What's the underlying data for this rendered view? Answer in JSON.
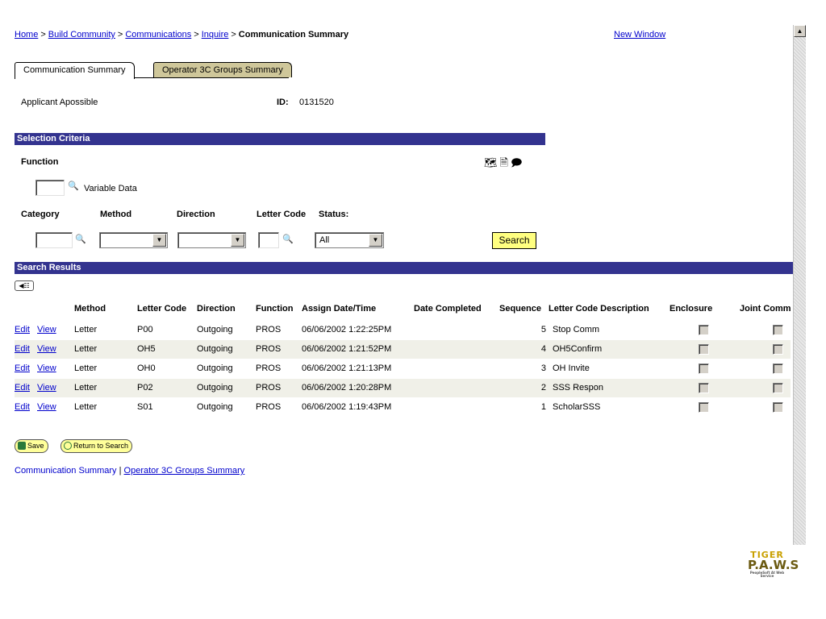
{
  "breadcrumb": {
    "items": [
      "Home",
      "Build Community",
      "Communications",
      "Inquire"
    ],
    "separator": ">",
    "current": "Communication Summary"
  },
  "new_window": "New Window",
  "tabs": [
    {
      "label": "Communication Summary",
      "active": true
    },
    {
      "label": "Operator 3C Groups Summary",
      "active": false
    }
  ],
  "applicant": {
    "name": "Applicant Apossible",
    "id_label": "ID:",
    "id_value": "0131520"
  },
  "selection": {
    "title": "Selection Criteria",
    "function_label": "Function",
    "variable_data": "Variable Data",
    "category_label": "Category",
    "method_label": "Method",
    "direction_label": "Direction",
    "letter_code_label": "Letter Code",
    "status_label": "Status:",
    "status_value": "All",
    "search_button": "Search",
    "tool_icons": [
      "download-to-excel-icon",
      "view-all-icon",
      "find-icon"
    ]
  },
  "results": {
    "title": "Search Results",
    "columns": [
      "Method",
      "Letter Code",
      "Direction",
      "Function",
      "Assign Date/Time",
      "Date Completed",
      "Sequence",
      "Letter Code Description",
      "Enclosure",
      "Joint Comm"
    ],
    "edit_label": "Edit",
    "view_label": "View",
    "rows": [
      {
        "method": "Letter",
        "letter_code": "P00",
        "direction": "Outgoing",
        "function": "PROS",
        "assign": "06/06/2002 1:22:25PM",
        "completed": "",
        "sequence": "5",
        "description": "Stop Comm"
      },
      {
        "method": "Letter",
        "letter_code": "OH5",
        "direction": "Outgoing",
        "function": "PROS",
        "assign": "06/06/2002 1:21:52PM",
        "completed": "",
        "sequence": "4",
        "description": "OH5Confirm"
      },
      {
        "method": "Letter",
        "letter_code": "OH0",
        "direction": "Outgoing",
        "function": "PROS",
        "assign": "06/06/2002 1:21:13PM",
        "completed": "",
        "sequence": "3",
        "description": "OH Invite"
      },
      {
        "method": "Letter",
        "letter_code": "P02",
        "direction": "Outgoing",
        "function": "PROS",
        "assign": "06/06/2002 1:20:28PM",
        "completed": "",
        "sequence": "2",
        "description": "SSS Respon"
      },
      {
        "method": "Letter",
        "letter_code": "S01",
        "direction": "Outgoing",
        "function": "PROS",
        "assign": "06/06/2002 1:19:43PM",
        "completed": "",
        "sequence": "1",
        "description": "ScholarSSS"
      }
    ]
  },
  "buttons": {
    "save": "Save",
    "return_to_search": "Return to Search"
  },
  "footer": {
    "current": "Communication Summary",
    "divider": "|",
    "link": "Operator 3C Groups Summary"
  },
  "logo": {
    "line1": "TIGER",
    "line2": "P.A.W.S",
    "line3": "PeopleSoft At Web Service"
  },
  "colors": {
    "band": "#33338f",
    "tab_inactive": "#cfc79a",
    "search_button": "#ffff80",
    "link": "#0000cc",
    "logo": "#c9a000"
  }
}
